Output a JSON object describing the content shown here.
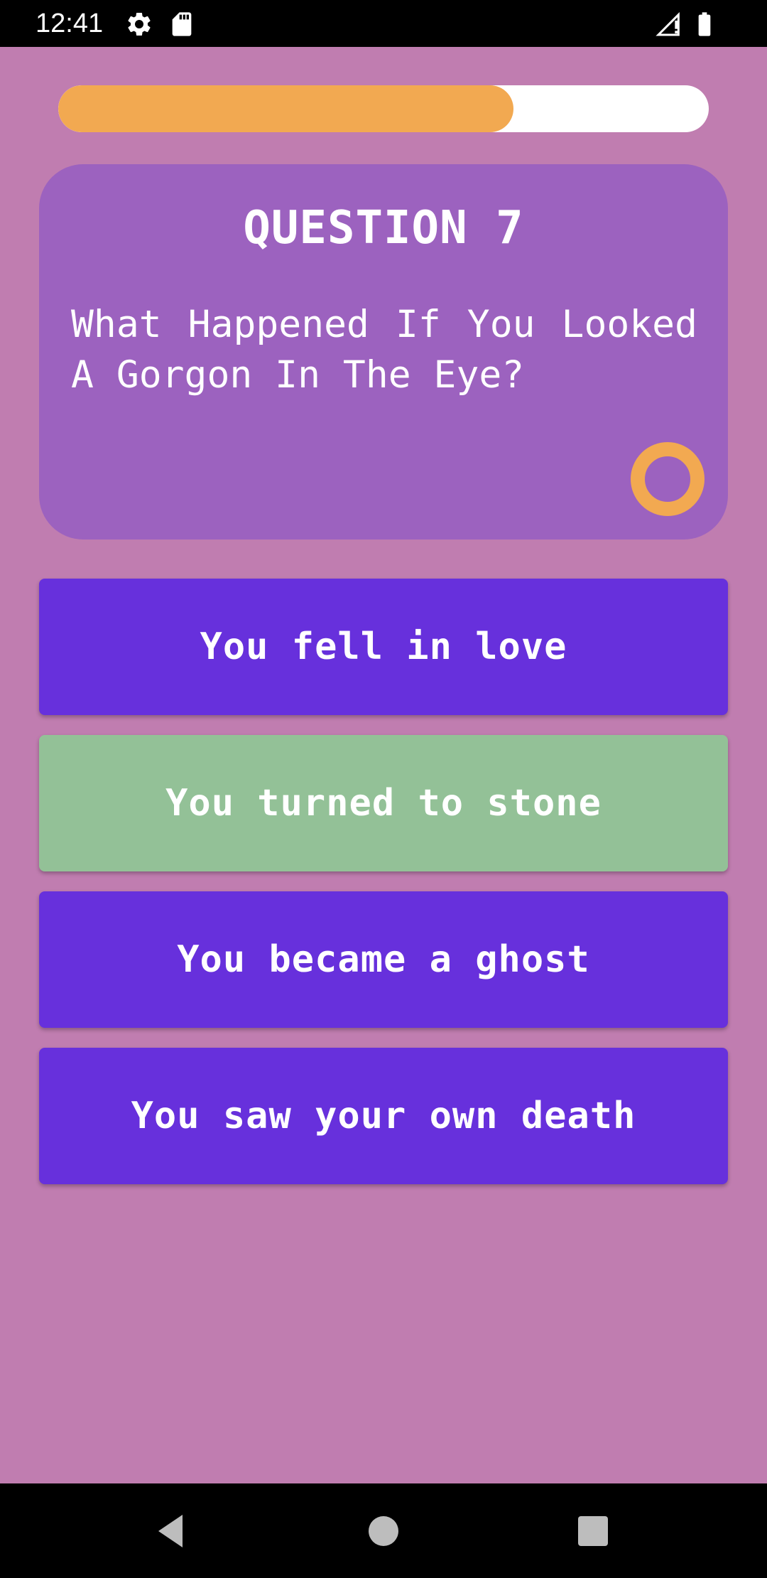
{
  "status_bar": {
    "time": "12:41",
    "icons": [
      "gear-icon",
      "sd-card-icon",
      "signal-icon",
      "battery-icon"
    ]
  },
  "progress": {
    "fraction": 0.7,
    "fill_color": "#f2a951",
    "track_color": "#ffffff"
  },
  "question": {
    "title": "QUESTION 7",
    "text": "What Happened If You Looked A Gorgon In The Eye?",
    "card_color": "#9c62bf",
    "timer_icon": "timer-ring-icon",
    "timer_color": "#f2a951"
  },
  "answers": [
    {
      "label": "You fell in love",
      "state": "default"
    },
    {
      "label": "You turned to stone",
      "state": "correct"
    },
    {
      "label": "You became a ghost",
      "state": "default"
    },
    {
      "label": "You saw your own death",
      "state": "default"
    }
  ],
  "colors": {
    "background": "#c07db0",
    "answer_default": "#6730dc",
    "answer_correct": "#93c197"
  },
  "nav_bar": {
    "icons": [
      "back-icon",
      "home-icon",
      "recents-icon"
    ]
  }
}
